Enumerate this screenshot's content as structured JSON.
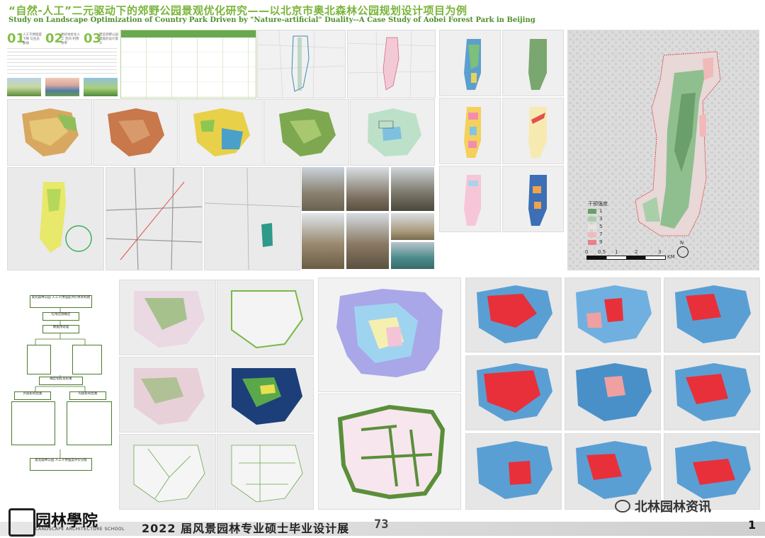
{
  "header": {
    "title_cn": "“自然-人工”二元驱动下的郊野公园景观优化研究——以北京市奥北森林公园规划设计项目为例",
    "title_en": "Study on Landscape Optimization of Country Park Driven by \"Nature-artificial\" Duality--A Case Study of Aobei Forest Park in Beijing"
  },
  "intro": {
    "items": [
      {
        "num": "01",
        "label": "人工干预程度下降 与生态脆弱"
      },
      {
        "num": "02",
        "label": "更好地优化人工 空间 利用效率"
      },
      {
        "num": "03",
        "label": "营造郊野公园 景观的设计意义"
      }
    ]
  },
  "main_map": {
    "legend_title": "干预强度",
    "legend": [
      {
        "label": "1",
        "color": "#6a9e6a"
      },
      {
        "label": "3",
        "color": "#a9cfa9"
      },
      {
        "label": "5",
        "color": "#e9e2e2"
      },
      {
        "label": "7",
        "color": "#f2b9b9"
      },
      {
        "label": "9",
        "color": "#e8808a"
      }
    ],
    "scale": [
      "0",
      "0.5",
      "1",
      "2",
      "3"
    ],
    "scale_unit": "KM",
    "north": "N"
  },
  "flowchart": {
    "nodes": [
      "奥北森林公园 人工干预强度评价体系构建",
      "红线范围确定",
      "数据预处理",
      "确定指标及权重",
      "外部影响因素",
      "内部影响因素",
      "奥北森林公园 人工干预强度评价分级"
    ]
  },
  "footer": {
    "school_cn": "园林學院",
    "school_en": "LANDSCAPE ARCHITECTURE SCHOOL",
    "exhibition": "2022 届风景园林专业硕士毕业设计展",
    "booth": "73",
    "page": "1",
    "watermark": "北林园林资讯"
  },
  "colors": {
    "title_green": "#7ab43a",
    "heat_red": "#e8303a",
    "heat_blue": "#5a9fd4"
  }
}
